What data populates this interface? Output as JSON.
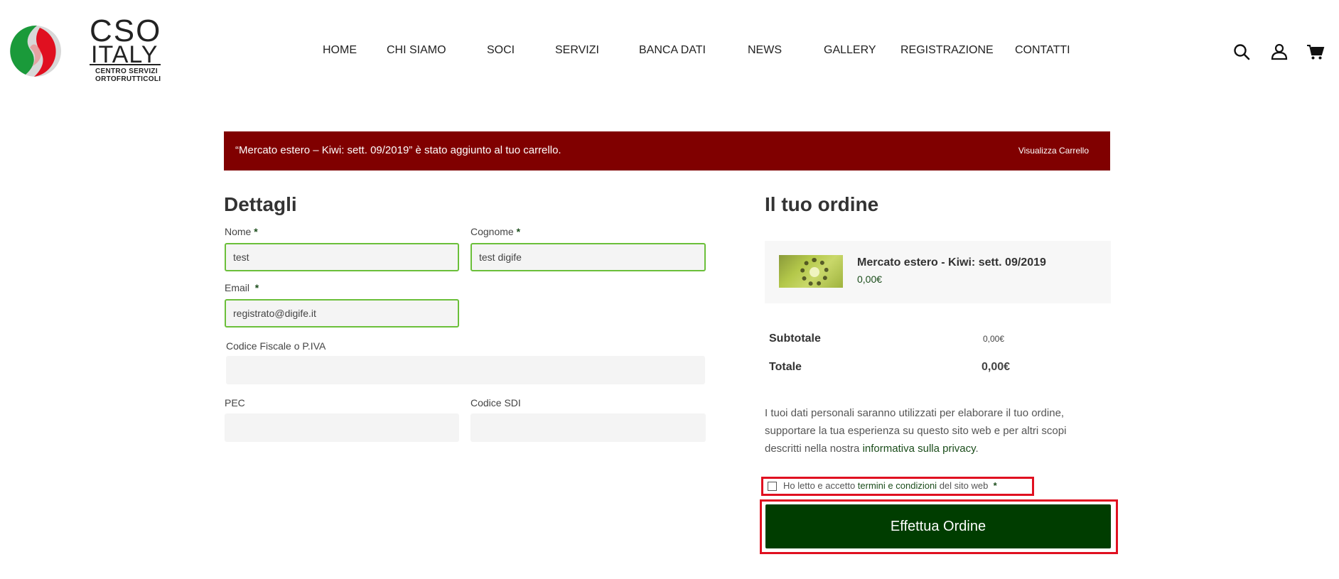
{
  "brand": {
    "name_line1": "CSO",
    "name_line2": "ITALY",
    "sub_line1": "CENTRO SERVIZI",
    "sub_line2": "ORTOFRUTTICOLI",
    "colors": {
      "green": "#1a9a3a",
      "red": "#e01020"
    }
  },
  "nav": {
    "items": [
      "HOME",
      "CHI SIAMO",
      "SOCI",
      "SERVIZI",
      "BANCA DATI",
      "NEWS",
      "GALLERY",
      "REGISTRAZIONE",
      "CONTATTI"
    ]
  },
  "header_icons": [
    "search-icon",
    "user-icon",
    "cart-icon"
  ],
  "notice": {
    "message": "“Mercato estero – Kiwi: sett. 09/2019” è stato aggiunto al tuo carrello.",
    "link": "Visualizza Carrello",
    "color": "#800000"
  },
  "details": {
    "title": "Dettagli",
    "fields": {
      "nome": {
        "label": "Nome",
        "required": "*",
        "value": "test"
      },
      "cognome": {
        "label": "Cognome",
        "required": "*",
        "value": "test digife"
      },
      "email": {
        "label": "Email",
        "required": "*",
        "value": "registrato@digife.it"
      },
      "codice_fiscale": {
        "label": "Codice Fiscale o P.IVA",
        "value": ""
      },
      "pec": {
        "label": "PEC",
        "value": ""
      },
      "codice_sdi": {
        "label": "Codice SDI",
        "value": ""
      }
    }
  },
  "order": {
    "title": "Il tuo ordine",
    "product": {
      "name": "Mercato estero - Kiwi: sett. 09/2019",
      "price": "0,00€"
    },
    "subtotal_label": "Subtotale",
    "subtotal_value": "0,00€",
    "total_label": "Totale",
    "total_value": "0,00€",
    "privacy_text": "I tuoi dati personali saranno utilizzati per elaborare il tuo ordine, supportare la tua esperienza su questo sito web e per altri scopi descritti nella nostra",
    "privacy_link": "informativa sulla privacy",
    "privacy_end": ".",
    "terms_prefix": "Ho letto e accetto",
    "terms_link": "termini e condizioni",
    "terms_suffix": "del sito web",
    "terms_required": "*",
    "place_order": "Effettua Ordine",
    "button_color": "#003d00"
  }
}
